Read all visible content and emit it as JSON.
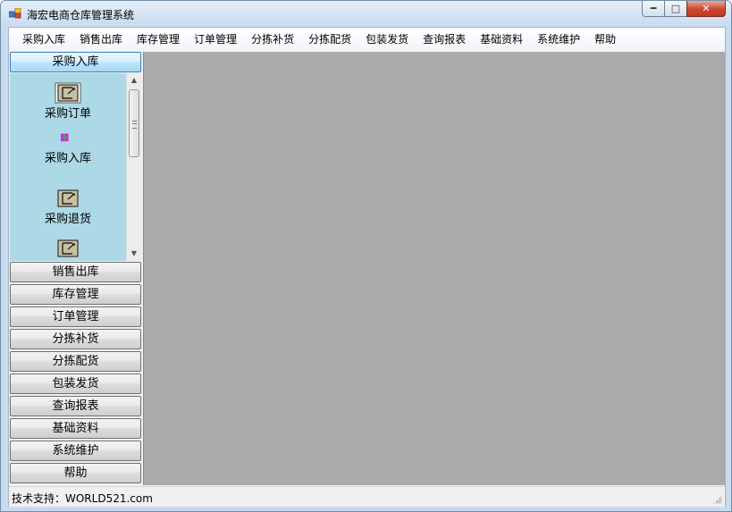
{
  "window": {
    "title": "海宏电商仓库管理系统"
  },
  "menu": [
    "采购入库",
    "销售出库",
    "库存管理",
    "订单管理",
    "分拣补货",
    "分拣配货",
    "包装发货",
    "查询报表",
    "基础资料",
    "系统维护",
    "帮助"
  ],
  "sidebar": {
    "active_group": "采购入库",
    "panel_items": [
      "采购订单",
      "采购入库",
      "采购退货"
    ],
    "groups": [
      "销售出库",
      "库存管理",
      "订单管理",
      "分拣补货",
      "分拣配货",
      "包装发货",
      "查询报表",
      "基础资料",
      "系统维护",
      "帮助"
    ]
  },
  "status": {
    "text": "技术支持：WORLD521.com"
  },
  "colors": {
    "panel_bg": "#add8e6",
    "content_bg": "#ababab",
    "close_button": "#c9472f"
  }
}
